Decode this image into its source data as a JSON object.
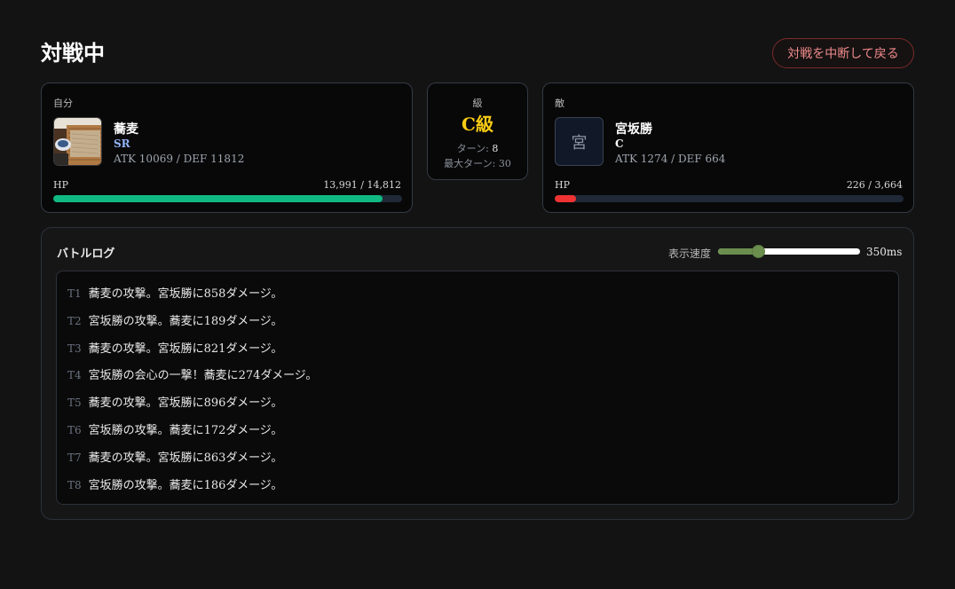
{
  "header": {
    "title": "対戦中",
    "abort_label": "対戦を中断して戻る"
  },
  "player": {
    "section_label": "自分",
    "name": "蕎麦",
    "rarity": "SR",
    "rarity_color": "#93b4f5",
    "stats": "ATK 10069 / DEF 11812",
    "hp_label": "HP",
    "hp_text": "13,991 / 14,812",
    "hp_fraction": 0.9446,
    "hp_color": "#10b981",
    "portrait": "soba-image"
  },
  "rank": {
    "title": "級",
    "value": "C級",
    "turn_label": "ターン:",
    "turn_value": "8",
    "max_turn_label": "最大ターン:",
    "max_turn_value": "30"
  },
  "enemy": {
    "section_label": "敵",
    "name": "宮坂勝",
    "rarity": "C",
    "rarity_color": "#ffffff",
    "stats": "ATK 1274 / DEF 664",
    "hp_label": "HP",
    "hp_text": "226 / 3,664",
    "hp_fraction": 0.0617,
    "hp_color": "#ef3333",
    "portrait_glyph": "宮"
  },
  "log": {
    "title": "バトルログ",
    "speed_label": "表示速度",
    "speed_value": "350ms",
    "speed_fraction": 0.26,
    "entries": [
      {
        "turn": "T1",
        "text": "蕎麦の攻撃。宮坂勝に858ダメージ。"
      },
      {
        "turn": "T2",
        "text": "宮坂勝の攻撃。蕎麦に189ダメージ。"
      },
      {
        "turn": "T3",
        "text": "蕎麦の攻撃。宮坂勝に821ダメージ。"
      },
      {
        "turn": "T4",
        "text": "宮坂勝の会心の一撃！蕎麦に274ダメージ。"
      },
      {
        "turn": "T5",
        "text": "蕎麦の攻撃。宮坂勝に896ダメージ。"
      },
      {
        "turn": "T6",
        "text": "宮坂勝の攻撃。蕎麦に172ダメージ。"
      },
      {
        "turn": "T7",
        "text": "蕎麦の攻撃。宮坂勝に863ダメージ。"
      },
      {
        "turn": "T8",
        "text": "宮坂勝の攻撃。蕎麦に186ダメージ。"
      }
    ]
  }
}
